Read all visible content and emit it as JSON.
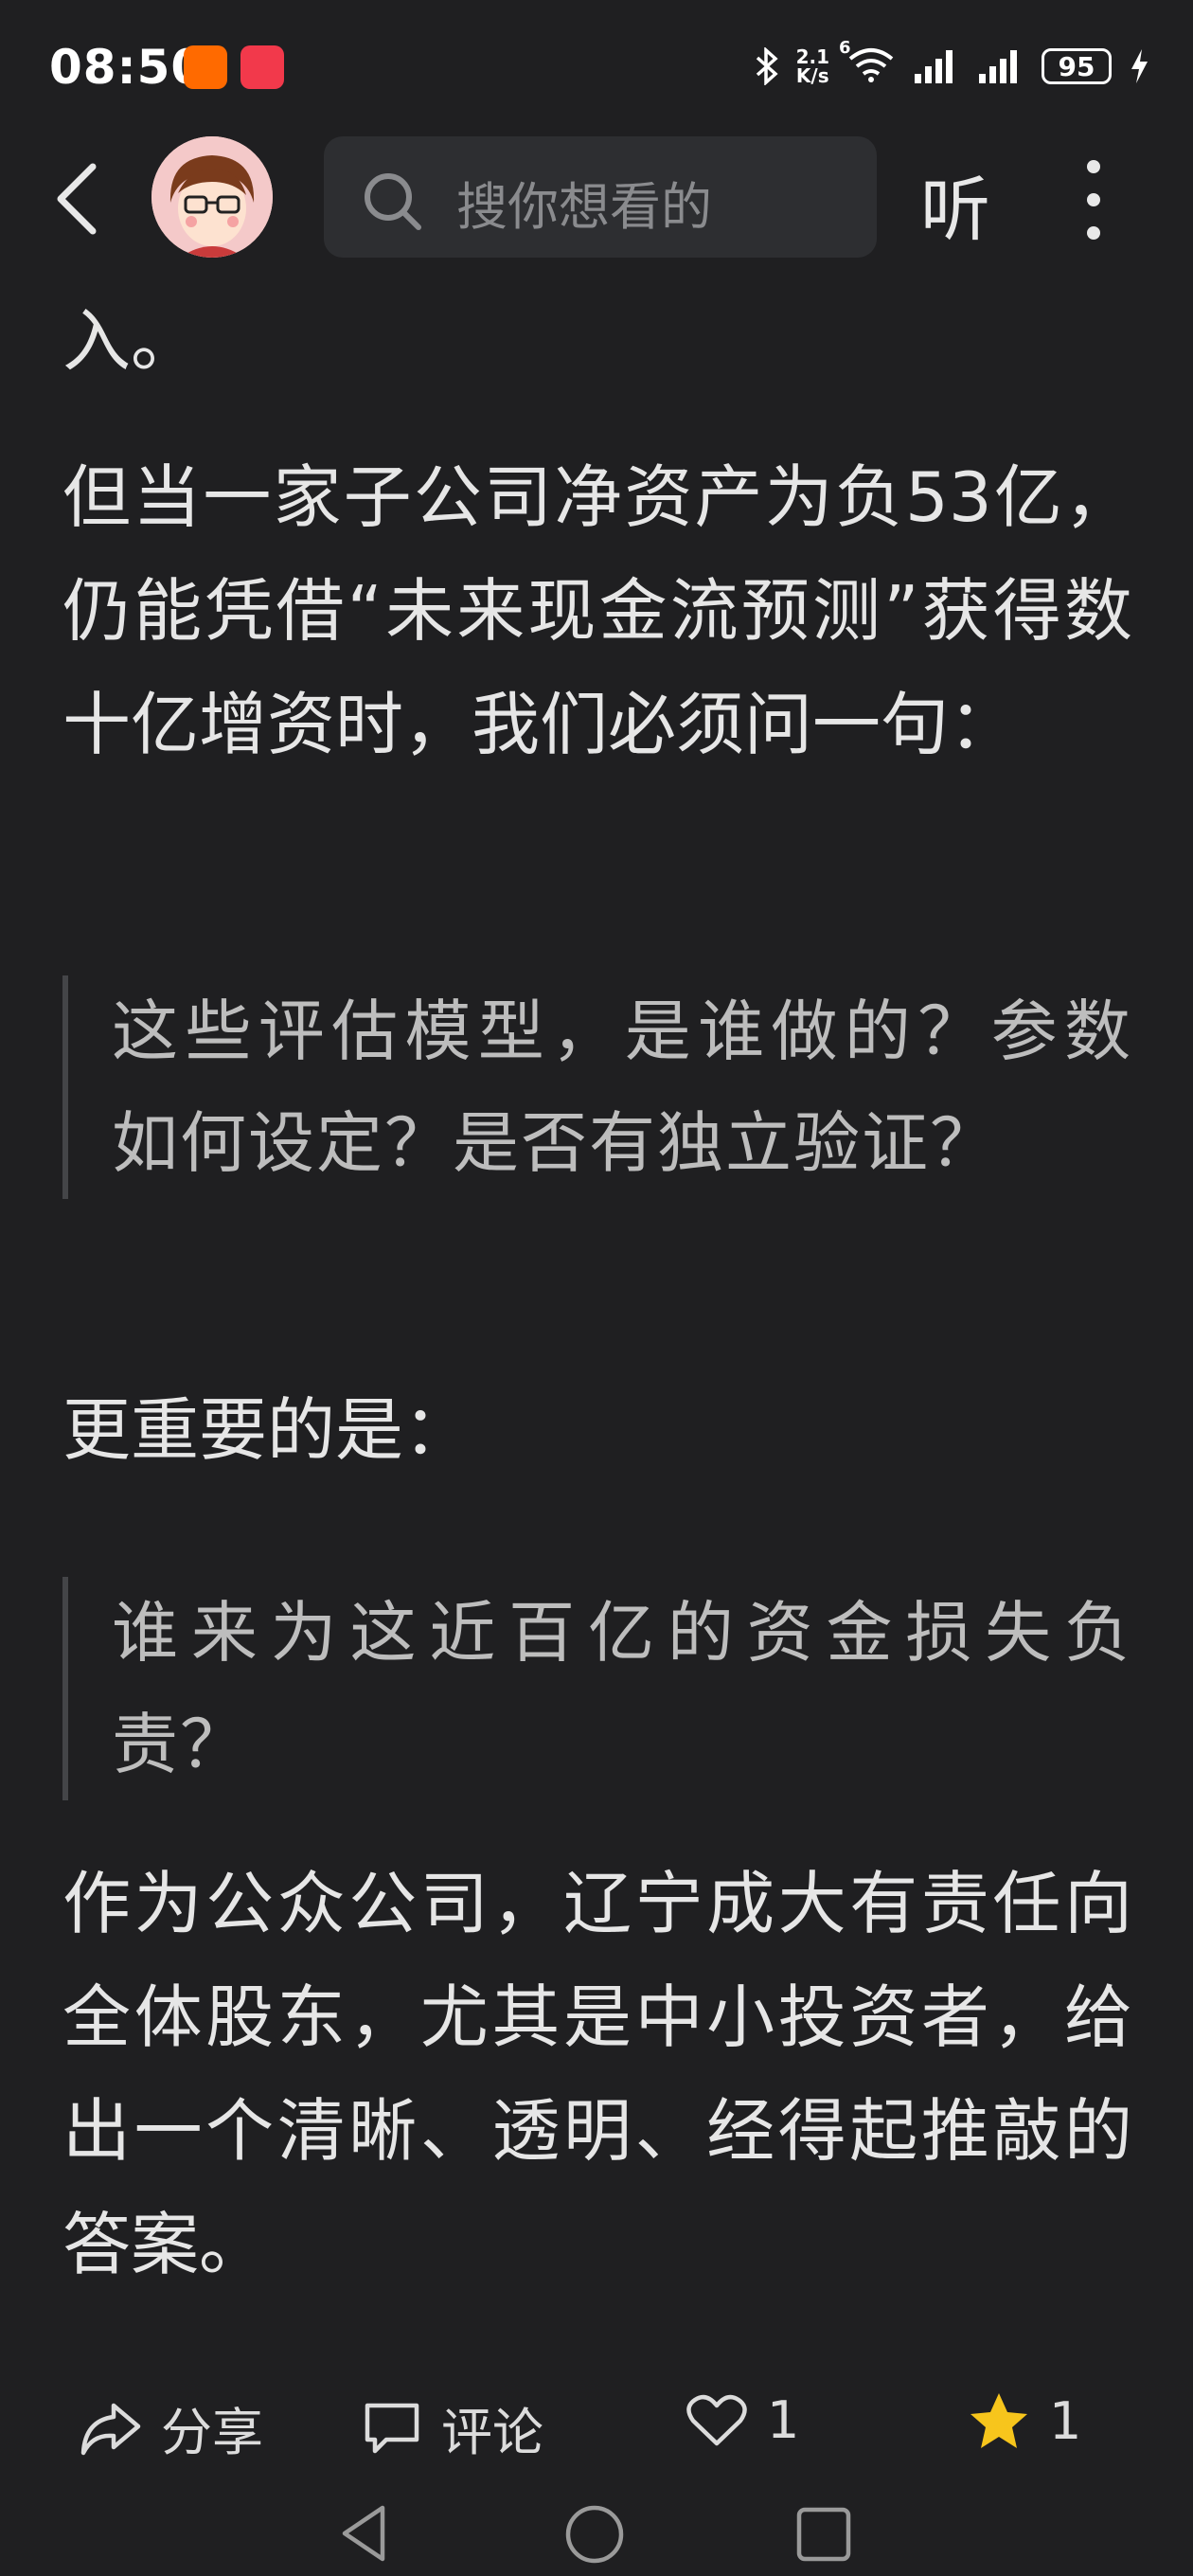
{
  "status_bar": {
    "time": "08:50",
    "net_speed_value": "2.1",
    "net_speed_unit": "K/s",
    "network_type": "6",
    "battery": "95"
  },
  "header": {
    "search_placeholder": "搜你想看的",
    "listen_label": "听"
  },
  "article": {
    "para_continued": "入。",
    "para_1": "但当一家子公司净资产为负53亿，仍能凭借“未来现金流预测”获得数十亿增资时，我们必须问一句：",
    "quote_1": "这些评估模型，是谁做的？参数如何设定？是否有独立验证？",
    "para_2": "更重要的是：",
    "quote_2": "谁来为这近百亿的资金损失负责？",
    "para_3": "作为公众公司，辽宁成大有责任向全体股东，尤其是中小投资者，给出一个清晰、透明、经得起推敲的答案。"
  },
  "actions": {
    "share_label": "分享",
    "comment_label": "评论",
    "like_count": "1",
    "favorite_count": "1"
  },
  "colors": {
    "background": "#1f1f21",
    "text": "#e6e6e6",
    "quote_text": "#bdbdbd",
    "star": "#f7c51c"
  }
}
